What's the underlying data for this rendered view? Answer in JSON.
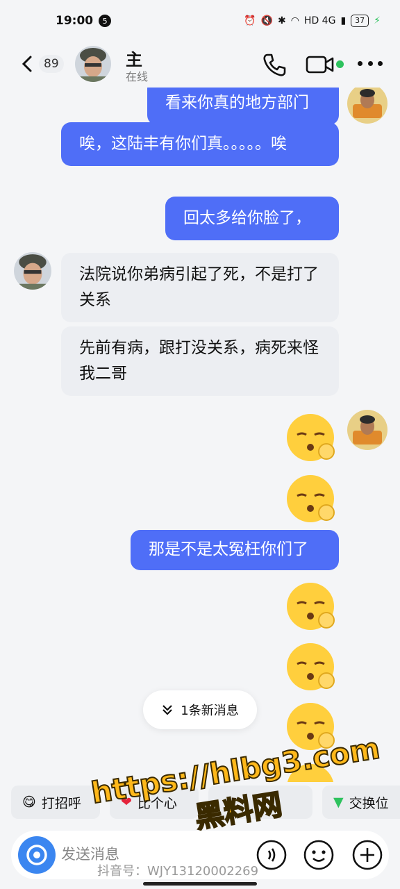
{
  "status_bar": {
    "time": "19:00",
    "notif_count": "5",
    "network": "HD 4G",
    "battery": "37"
  },
  "header": {
    "unread_count": "89",
    "contact_name": "主",
    "contact_status": "在线"
  },
  "messages": [
    {
      "side": "out",
      "text": "看来你真的地方部门"
    },
    {
      "side": "out",
      "text": "唉，这陆丰有你们真。。。。。唉"
    },
    {
      "side": "out",
      "text": "回太多给你脸了，"
    },
    {
      "side": "in",
      "text": "法院说你弟病引起了死，不是打了关系"
    },
    {
      "side": "in",
      "text": "先前有病，跟打没关系，病死来怪我二哥"
    },
    {
      "side": "out",
      "emoji": "sleepy-face"
    },
    {
      "side": "out",
      "emoji": "sleepy-face"
    },
    {
      "side": "out",
      "text": "那是不是太冤枉你们了"
    },
    {
      "side": "out",
      "emoji": "sleepy-face"
    },
    {
      "side": "out",
      "emoji": "sleepy-face"
    },
    {
      "side": "out",
      "emoji": "sleepy-face"
    }
  ],
  "new_messages_label": "1条新消息",
  "quick_replies": [
    "打招呼",
    "比个心",
    "",
    "交换位"
  ],
  "input": {
    "placeholder": "发送消息"
  },
  "overlay": {
    "url": "https://hlbg3.com",
    "site": "黑料网",
    "tiktok_id": "抖音号：WJY13120002269"
  },
  "colors": {
    "outgoing_bubble": "#4f6ef7",
    "incoming_bubble": "#eceef2",
    "online": "#2ec25e",
    "camera_button": "#3b86f0"
  }
}
